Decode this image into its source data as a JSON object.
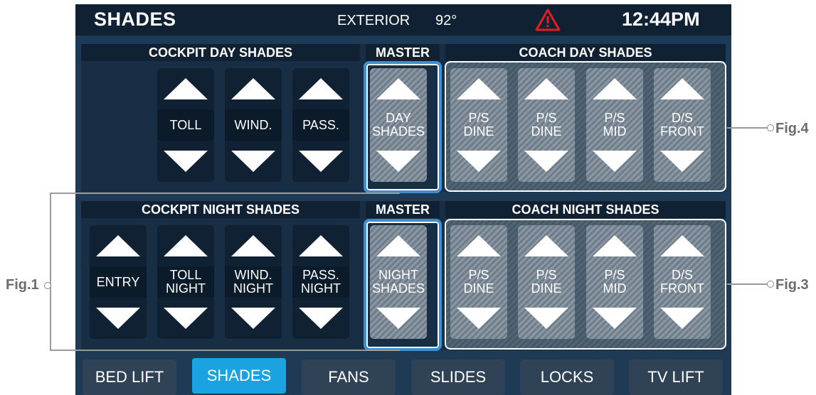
{
  "topbar": {
    "title": "SHADES",
    "exterior_label": "EXTERIOR",
    "temperature": "92°",
    "time": "12:44PM",
    "warning_icon": "warning-triangle-icon",
    "warning_color": "#e02020"
  },
  "day": {
    "cockpit_header": "COCKPIT DAY SHADES",
    "master_header": "MASTER",
    "coach_header": "COACH DAY SHADES",
    "cockpit_buttons": [
      "TOLL",
      "WIND.",
      "PASS."
    ],
    "master_button": "DAY\nSHADES",
    "coach_buttons": [
      "P/S\nDINE",
      "P/S\nDINE",
      "P/S\nMID",
      "D/S\nFRONT"
    ]
  },
  "night": {
    "cockpit_header": "COCKPIT NIGHT SHADES",
    "master_header": "MASTER",
    "coach_header": "COACH NIGHT SHADES",
    "cockpit_buttons": [
      "ENTRY",
      "TOLL\nNIGHT",
      "WIND.\nNIGHT",
      "PASS.\nNIGHT"
    ],
    "master_button": "NIGHT\nSHADES",
    "coach_buttons": [
      "P/S\nDINE",
      "P/S\nDINE",
      "P/S\nMID",
      "D/S\nFRONT"
    ]
  },
  "nav": [
    "BED LIFT",
    "SHADES",
    "FANS",
    "SLIDES",
    "LOCKS",
    "TV LIFT"
  ],
  "nav_active": "SHADES",
  "figures": {
    "fig1": "Fig.1",
    "fig3": "Fig.3",
    "fig4": "Fig.4"
  },
  "colors": {
    "accent": "#1aa3e0",
    "master_border": "#3e8fd0",
    "background": "#1f3a55"
  }
}
